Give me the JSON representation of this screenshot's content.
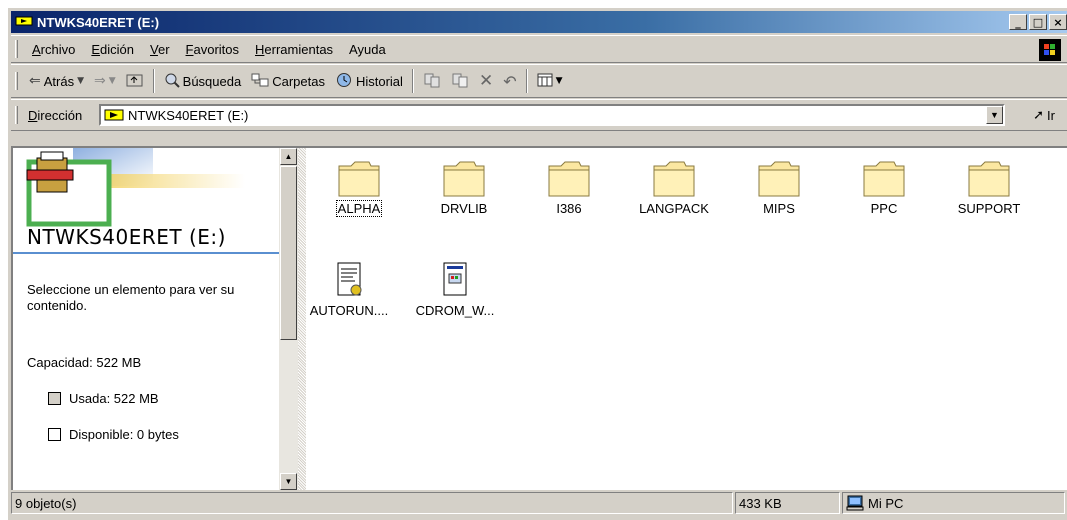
{
  "window": {
    "title": "NTWKS40ERET (E:)"
  },
  "menu": [
    {
      "underline": "A",
      "rest": "rchivo"
    },
    {
      "underline": "E",
      "rest": "dición"
    },
    {
      "underline": "V",
      "rest": "er"
    },
    {
      "underline": "F",
      "rest": "avoritos"
    },
    {
      "underline": "H",
      "rest": "erramientas"
    },
    {
      "underline": "",
      "rest": "Ayuda"
    }
  ],
  "toolbar": {
    "back": "Atrás",
    "search": "Búsqueda",
    "folders": "Carpetas",
    "history": "Historial"
  },
  "address": {
    "label_underline": "D",
    "label_rest": "irección",
    "value": "NTWKS40ERET (E:)",
    "go": "Ir"
  },
  "leftpane": {
    "title": "NTWKS40ERET (E:)",
    "prompt": "Seleccione un elemento para ver su contenido.",
    "capacity": "Capacidad: 522 MB",
    "used": "Usada: 522 MB",
    "free": "Disponible: 0 bytes",
    "colors": {
      "used": "#d4d0c8",
      "free": "#ffffff"
    }
  },
  "files": [
    {
      "name": "ALPHA",
      "type": "folder",
      "selected": true
    },
    {
      "name": "DRVLIB",
      "type": "folder"
    },
    {
      "name": "I386",
      "type": "folder"
    },
    {
      "name": "LANGPACK",
      "type": "folder"
    },
    {
      "name": "MIPS",
      "type": "folder"
    },
    {
      "name": "PPC",
      "type": "folder"
    },
    {
      "name": "SUPPORT",
      "type": "folder"
    },
    {
      "name": "AUTORUN....",
      "type": "setup-file"
    },
    {
      "name": "CDROM_W...",
      "type": "system-file"
    }
  ],
  "status": {
    "objects": "9 objeto(s)",
    "size": "433 KB",
    "zone": "Mi PC"
  }
}
